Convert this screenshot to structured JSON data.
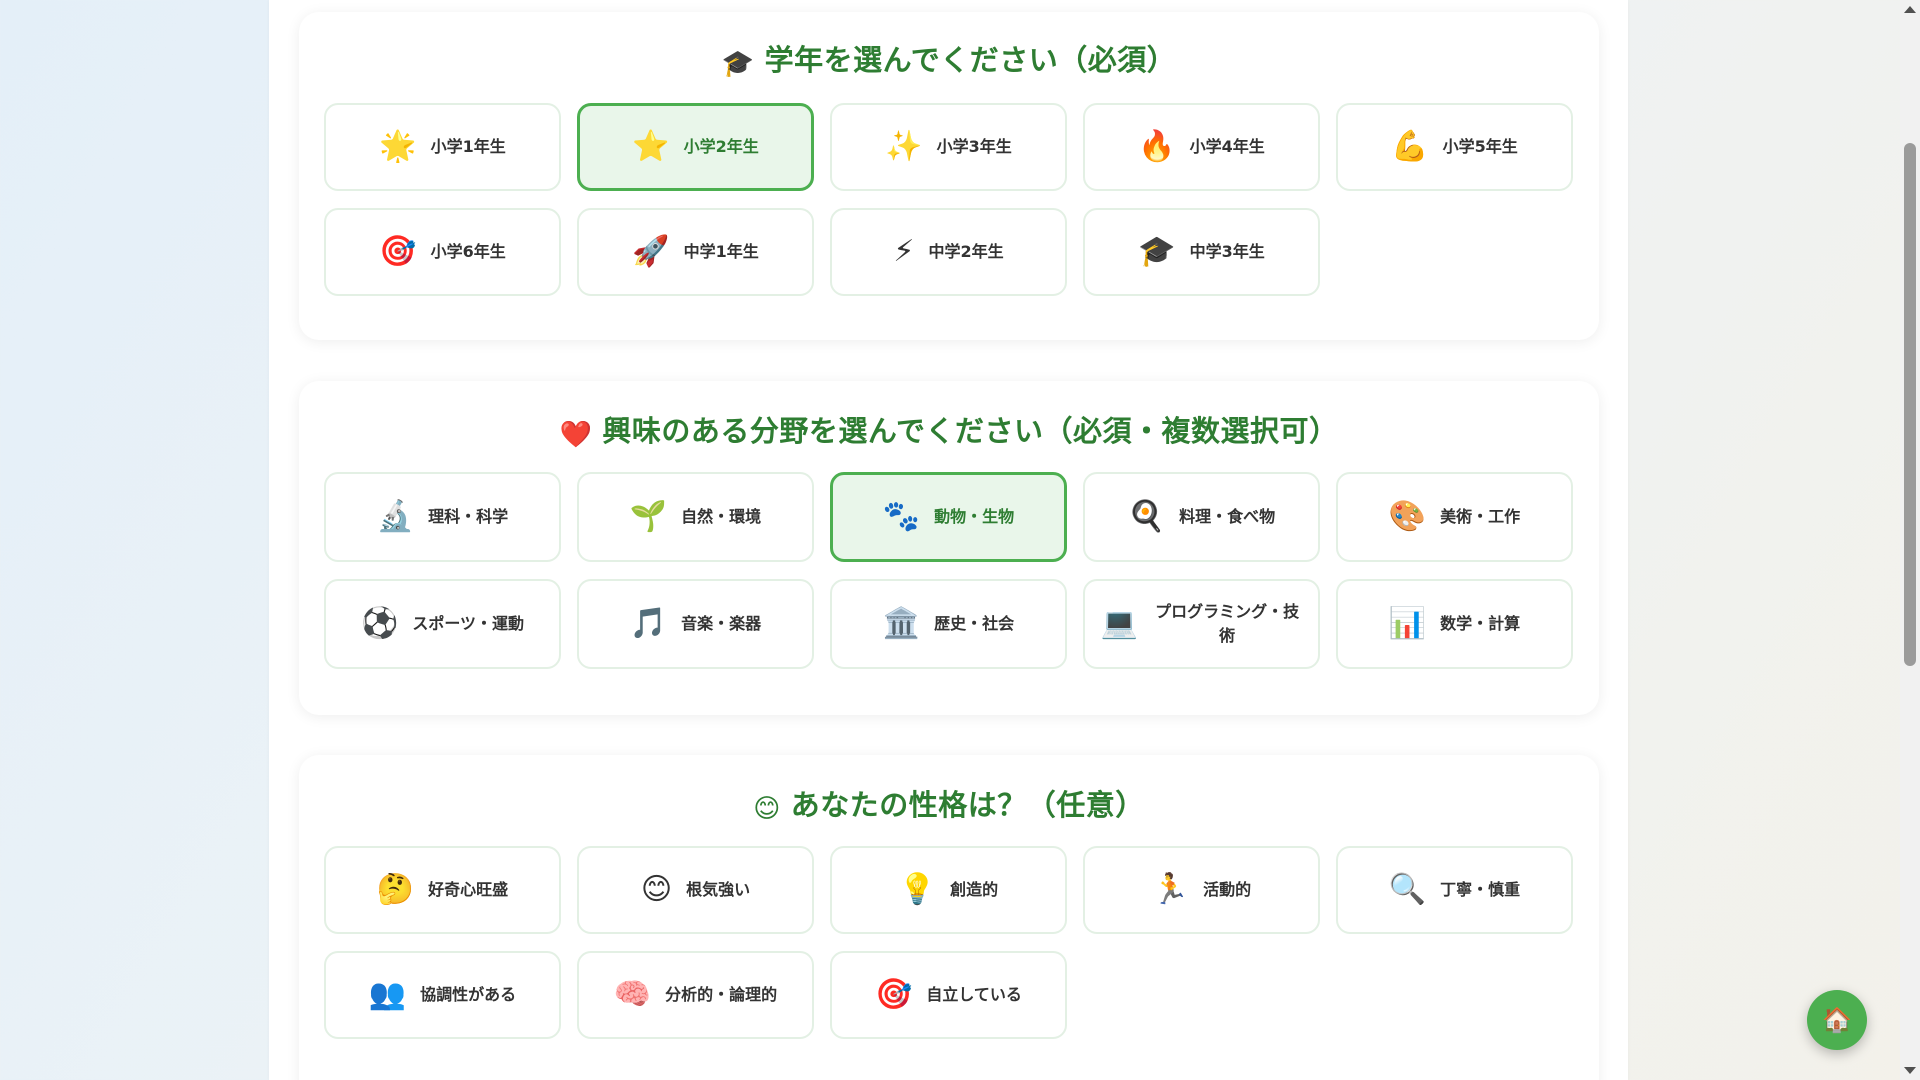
{
  "grade_section": {
    "title_icon": "🎓",
    "title": "学年を選んでください（必須）",
    "options": [
      {
        "icon": "🌟",
        "label": "小学1年生",
        "selected": false
      },
      {
        "icon": "⭐",
        "label": "小学2年生",
        "selected": true
      },
      {
        "icon": "✨",
        "label": "小学3年生",
        "selected": false
      },
      {
        "icon": "🔥",
        "label": "小学4年生",
        "selected": false
      },
      {
        "icon": "💪",
        "label": "小学5年生",
        "selected": false
      },
      {
        "icon": "🎯",
        "label": "小学6年生",
        "selected": false
      },
      {
        "icon": "🚀",
        "label": "中学1年生",
        "selected": false
      },
      {
        "icon": "⚡",
        "label": "中学2年生",
        "selected": false
      },
      {
        "icon": "🎓",
        "label": "中学3年生",
        "selected": false
      }
    ]
  },
  "interest_section": {
    "title_icon": "❤️",
    "title": "興味のある分野を選んでください（必須・複数選択可）",
    "options": [
      {
        "icon": "🔬",
        "label": "理科・科学",
        "selected": false
      },
      {
        "icon": "🌱",
        "label": "自然・環境",
        "selected": false
      },
      {
        "icon": "🐾",
        "label": "動物・生物",
        "selected": true
      },
      {
        "icon": "🍳",
        "label": "料理・食べ物",
        "selected": false
      },
      {
        "icon": "🎨",
        "label": "美術・工作",
        "selected": false
      },
      {
        "icon": "⚽",
        "label": "スポーツ・運動",
        "selected": false
      },
      {
        "icon": "🎵",
        "label": "音楽・楽器",
        "selected": false
      },
      {
        "icon": "🏛️",
        "label": "歴史・社会",
        "selected": false
      },
      {
        "icon": "💻",
        "label": "プログラミング・技術",
        "selected": false
      },
      {
        "icon": "📊",
        "label": "数学・計算",
        "selected": false
      }
    ]
  },
  "personality_section": {
    "title_icon": "😊",
    "title": "あなたの性格は？（任意）",
    "options": [
      {
        "icon": "🤔",
        "label": "好奇心旺盛",
        "selected": false
      },
      {
        "icon": "😊",
        "label": "根気強い",
        "selected": false
      },
      {
        "icon": "💡",
        "label": "創造的",
        "selected": false
      },
      {
        "icon": "🏃",
        "label": "活動的",
        "selected": false
      },
      {
        "icon": "🔍",
        "label": "丁寧・慎重",
        "selected": false
      },
      {
        "icon": "👥",
        "label": "協調性がある",
        "selected": false
      },
      {
        "icon": "🧠",
        "label": "分析的・論理的",
        "selected": false
      },
      {
        "icon": "🎯",
        "label": "自立している",
        "selected": false
      }
    ]
  },
  "home_button": {
    "icon": "🏠"
  },
  "colors": {
    "accent": "#2e7d32",
    "selected_border": "#4caf50",
    "selected_bg": "#e9f6ea",
    "option_border": "#e3f0e4"
  }
}
